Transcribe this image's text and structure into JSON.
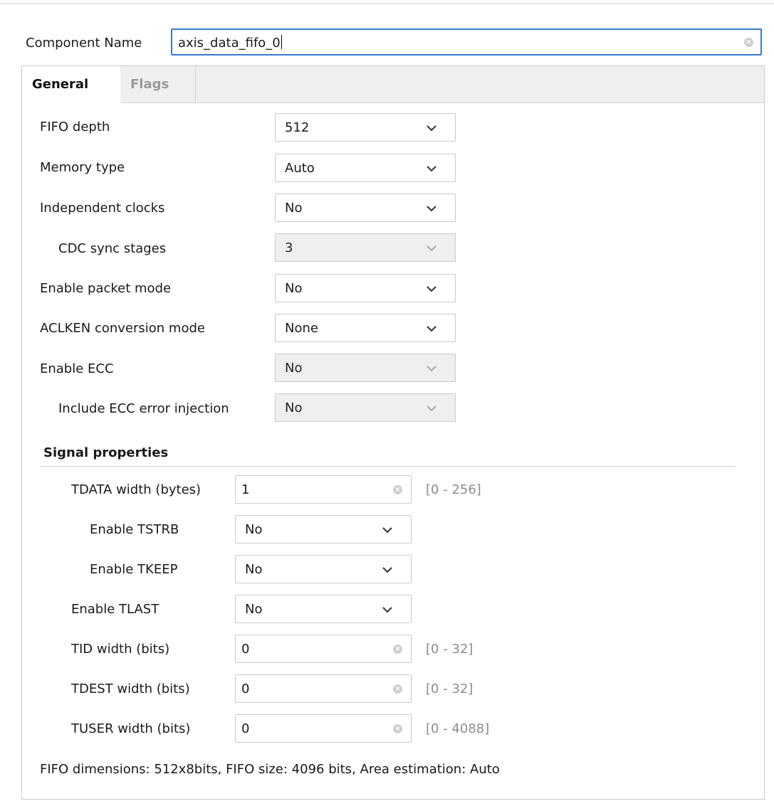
{
  "component_name": {
    "label": "Component Name",
    "value": "axis_data_fifo_0"
  },
  "tabs": [
    {
      "label": "General",
      "active": true
    },
    {
      "label": "Flags",
      "active": false
    }
  ],
  "general": {
    "fifo_depth": {
      "label": "FIFO depth",
      "value": "512"
    },
    "memory_type": {
      "label": "Memory type",
      "value": "Auto"
    },
    "independent_clocks": {
      "label": "Independent clocks",
      "value": "No"
    },
    "cdc_sync_stages": {
      "label": "CDC sync stages",
      "value": "3",
      "disabled": true
    },
    "enable_packet_mode": {
      "label": "Enable packet mode",
      "value": "No"
    },
    "aclken_conversion_mode": {
      "label": "ACLKEN conversion mode",
      "value": "None"
    },
    "enable_ecc": {
      "label": "Enable ECC",
      "value": "No",
      "disabled": true
    },
    "include_ecc_error_injection": {
      "label": "Include ECC error injection",
      "value": "No",
      "disabled": true
    }
  },
  "signal_properties": {
    "title": "Signal properties",
    "tdata_width": {
      "label": "TDATA width (bytes)",
      "value": "1",
      "range": "[0 - 256]"
    },
    "enable_tstrb": {
      "label": "Enable TSTRB",
      "value": "No"
    },
    "enable_tkeep": {
      "label": "Enable TKEEP",
      "value": "No"
    },
    "enable_tlast": {
      "label": "Enable TLAST",
      "value": "No"
    },
    "tid_width": {
      "label": "TID width (bits)",
      "value": "0",
      "range": "[0 - 32]"
    },
    "tdest_width": {
      "label": "TDEST width (bits)",
      "value": "0",
      "range": "[0 - 32]"
    },
    "tuser_width": {
      "label": "TUSER width (bits)",
      "value": "0",
      "range": "[0 - 4088]"
    }
  },
  "footer": "FIFO dimensions: 512x8bits, FIFO size: 4096 bits, Area estimation: Auto",
  "colors": {
    "focus_border": "#3a78c9",
    "disabled_bg": "#efefef",
    "tab_bar_bg": "#efefef"
  },
  "icons": {
    "dropdown": "chevron-down-icon",
    "clear": "clear-icon"
  }
}
